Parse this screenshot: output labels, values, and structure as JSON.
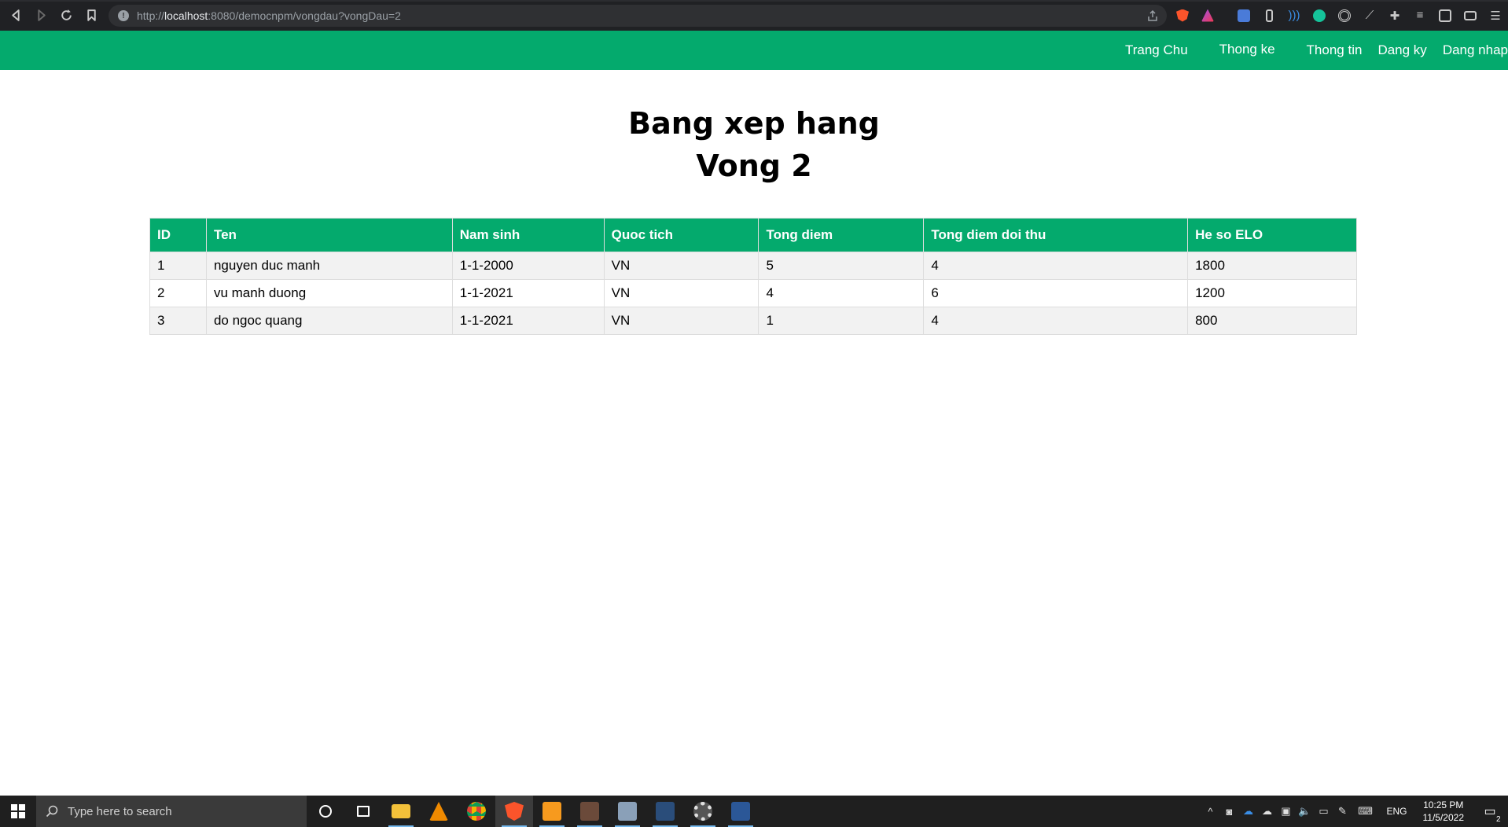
{
  "browser": {
    "url_prefix": "http://",
    "url_host": "localhost",
    "url_rest": ":8080/democnpm/vongdau?vongDau=2"
  },
  "nav": {
    "links": [
      "Trang Chu",
      "Thong ke",
      "Thong tin",
      "Dang ky",
      "Dang nhap"
    ]
  },
  "page": {
    "title_line1": "Bang xep hang",
    "title_line2": "Vong 2"
  },
  "table": {
    "headers": [
      "ID",
      "Ten",
      "Nam sinh",
      "Quoc tich",
      "Tong diem",
      "Tong diem doi thu",
      "He so ELO"
    ],
    "rows": [
      [
        "1",
        "nguyen duc manh",
        "1-1-2000",
        "VN",
        "5",
        "4",
        "1800"
      ],
      [
        "2",
        "vu manh duong",
        "1-1-2021",
        "VN",
        "4",
        "6",
        "1200"
      ],
      [
        "3",
        "do ngoc quang",
        "1-1-2021",
        "VN",
        "1",
        "4",
        "800"
      ]
    ]
  },
  "taskbar": {
    "search_placeholder": "Type here to search",
    "language": "ENG",
    "time": "10:25 PM",
    "date": "11/5/2022",
    "notification_count": "2"
  },
  "colors": {
    "accent_green": "#04aa6d",
    "row_stripe": "#f2f2f2",
    "browser_chrome": "#202124",
    "taskbar": "#1f1f1f"
  }
}
